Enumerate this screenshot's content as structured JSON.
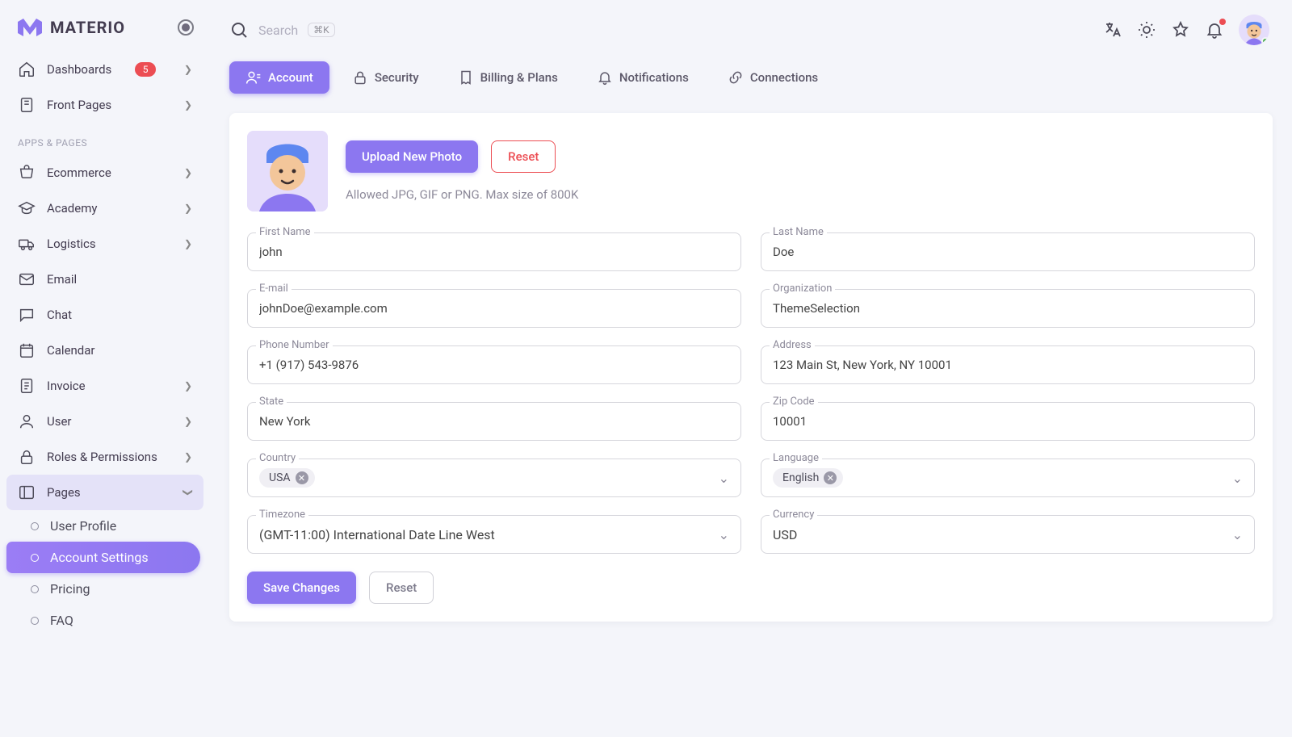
{
  "brand": "MATERIO",
  "sidebar": {
    "dashboards": "Dashboards",
    "dash_badge": "5",
    "frontpages": "Front Pages",
    "section_apps": "APPS & PAGES",
    "ecommerce": "Ecommerce",
    "academy": "Academy",
    "logistics": "Logistics",
    "email": "Email",
    "chat": "Chat",
    "calendar": "Calendar",
    "invoice": "Invoice",
    "user": "User",
    "roles": "Roles & Permissions",
    "pages": "Pages",
    "sub_user_profile": "User Profile",
    "sub_account_settings": "Account Settings",
    "sub_pricing": "Pricing",
    "sub_faq": "FAQ"
  },
  "topbar": {
    "search_placeholder": "Search",
    "shortcut": "⌘K"
  },
  "tabs": {
    "account": "Account",
    "security": "Security",
    "billing": "Billing & Plans",
    "notifications": "Notifications",
    "connections": "Connections"
  },
  "upload": {
    "btn_upload": "Upload New Photo",
    "btn_reset": "Reset",
    "hint": "Allowed JPG, GIF or PNG. Max size of 800K"
  },
  "form": {
    "first_name": {
      "label": "First Name",
      "value": "john"
    },
    "last_name": {
      "label": "Last Name",
      "value": "Doe"
    },
    "email": {
      "label": "E-mail",
      "value": "johnDoe@example.com"
    },
    "org": {
      "label": "Organization",
      "value": "ThemeSelection"
    },
    "phone": {
      "label": "Phone Number",
      "value": "+1 (917) 543-9876"
    },
    "address": {
      "label": "Address",
      "value": "123 Main St, New York, NY 10001"
    },
    "state": {
      "label": "State",
      "value": "New York"
    },
    "zip": {
      "label": "Zip Code",
      "value": "10001"
    },
    "country": {
      "label": "Country",
      "chip": "USA"
    },
    "language": {
      "label": "Language",
      "chip": "English"
    },
    "timezone": {
      "label": "Timezone",
      "value": "(GMT-11:00) International Date Line West"
    },
    "currency": {
      "label": "Currency",
      "value": "USD"
    }
  },
  "actions": {
    "save": "Save Changes",
    "reset": "Reset"
  }
}
